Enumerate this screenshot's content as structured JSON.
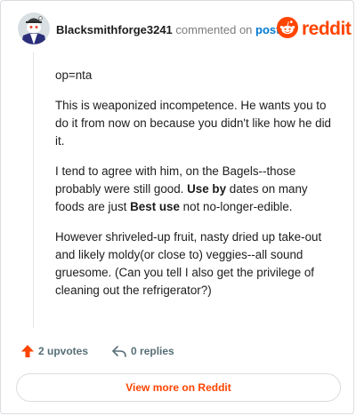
{
  "header": {
    "username": "Blacksmithforge3241",
    "action_text": "commented on",
    "post_link": "post",
    "brand_name": "reddit",
    "avatar_icon": "snoo-avatar-icon",
    "brand_icon": "reddit-alien-icon"
  },
  "comment": {
    "paragraphs": [
      {
        "text": "op=nta"
      },
      {
        "text": "This is weaponized incompetence. He wants you to do it from now on because you didn't like how he did it."
      },
      {
        "p1": "I tend to agree with him, on the Bagels--those probably were still good. ",
        "b1": "Use by",
        "p2": " dates on many foods are just ",
        "b2": "Best use",
        "p3": " not no-longer-edible."
      },
      {
        "text": "However shriveled-up fruit, nasty dried up take-out and likely moldy(or close to) veggies--all sound gruesome. (Can you tell I also get the privilege of cleaning out the refrigerator?)"
      }
    ]
  },
  "actions": {
    "upvotes": "2 upvotes",
    "replies": "0 replies",
    "upvote_icon": "upvote-arrow-icon",
    "reply_icon": "reply-arrow-icon"
  },
  "footer": {
    "view_more": "View more on Reddit"
  },
  "colors": {
    "brand": "#ff4500",
    "link": "#0079d3",
    "muted": "#576f76"
  }
}
